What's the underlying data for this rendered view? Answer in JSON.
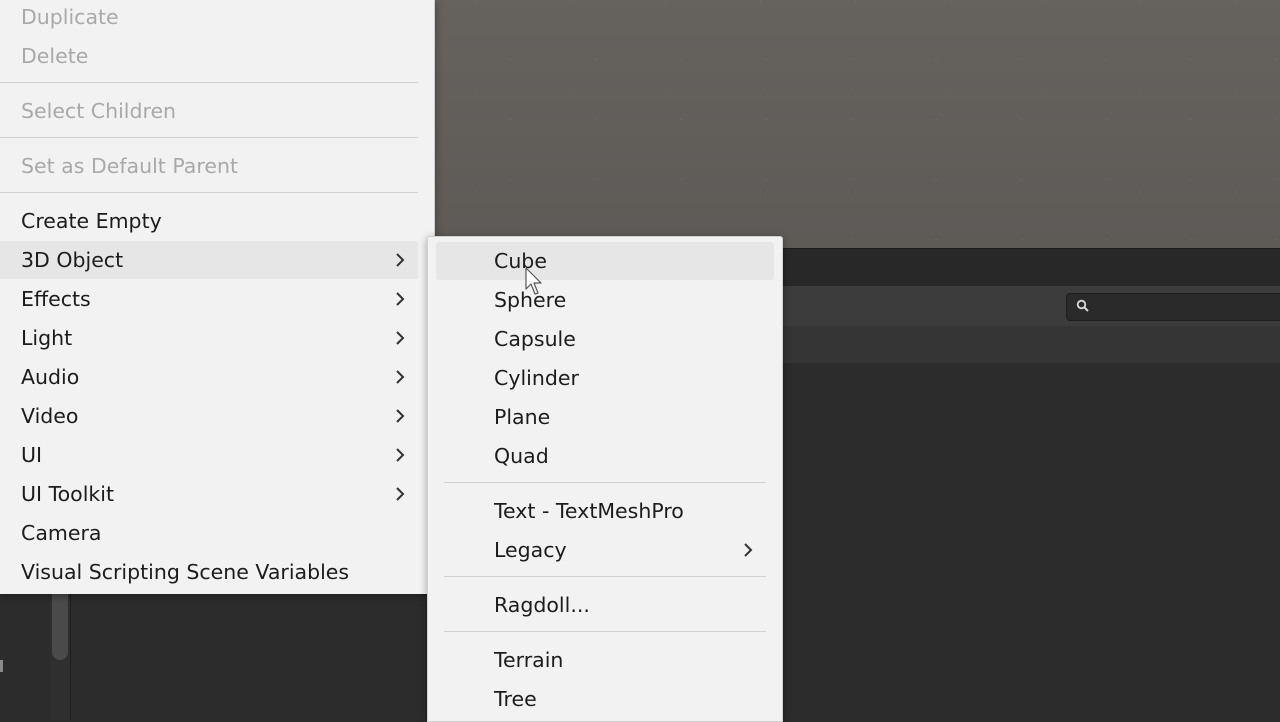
{
  "main_menu": {
    "items": [
      {
        "label": "Duplicate",
        "disabled": true
      },
      {
        "label": "Delete",
        "disabled": true
      },
      {
        "label": "Select Children",
        "disabled": true
      },
      {
        "label": "Set as Default Parent",
        "disabled": true
      },
      {
        "label": "Create Empty",
        "disabled": false
      },
      {
        "label": "3D Object",
        "disabled": false,
        "submenu": true,
        "highlighted": true
      },
      {
        "label": "Effects",
        "disabled": false,
        "submenu": true
      },
      {
        "label": "Light",
        "disabled": false,
        "submenu": true
      },
      {
        "label": "Audio",
        "disabled": false,
        "submenu": true
      },
      {
        "label": "Video",
        "disabled": false,
        "submenu": true
      },
      {
        "label": "UI",
        "disabled": false,
        "submenu": true
      },
      {
        "label": "UI Toolkit",
        "disabled": false,
        "submenu": true
      },
      {
        "label": "Camera",
        "disabled": false
      },
      {
        "label": "Visual Scripting Scene Variables",
        "disabled": false
      }
    ]
  },
  "submenu_3d_object": {
    "items": [
      {
        "label": "Cube",
        "highlighted": true
      },
      {
        "label": "Sphere"
      },
      {
        "label": "Capsule"
      },
      {
        "label": "Cylinder"
      },
      {
        "label": "Plane"
      },
      {
        "label": "Quad"
      },
      {
        "label": "Text - TextMeshPro"
      },
      {
        "label": "Legacy",
        "submenu": true
      },
      {
        "label": "Ragdoll..."
      },
      {
        "label": "Terrain"
      },
      {
        "label": "Tree"
      }
    ]
  },
  "icons": {
    "submenu_arrow": "chevron-right-icon",
    "search": "search-icon",
    "cursor": "mouse-pointer-icon"
  },
  "colors": {
    "menu_bg": "#f2f2f2",
    "menu_text": "#1c1c1c",
    "menu_disabled_text": "#a9a9a9",
    "highlight_bg": "#e6e6e6",
    "scene_bg": "#6b6763",
    "panel_bg": "#2c2c2c"
  }
}
